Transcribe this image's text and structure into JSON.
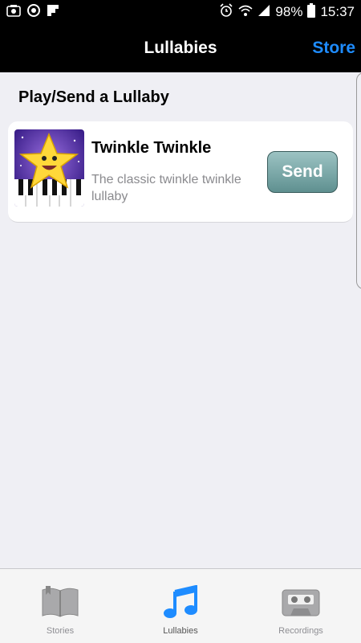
{
  "status_bar": {
    "battery": "98%",
    "time": "15:37"
  },
  "nav": {
    "title": "Lullabies",
    "store_label": "Store"
  },
  "section": {
    "title": "Play/Send a Lullaby"
  },
  "items": [
    {
      "title": "Twinkle Twinkle",
      "description": "The classic twinkle twinkle lullaby",
      "send_label": "Send",
      "thumbnail_icon": "star-piano-icon"
    }
  ],
  "tabs": [
    {
      "label": "Stories",
      "icon": "book-icon",
      "active": false
    },
    {
      "label": "Lullabies",
      "icon": "music-note-icon",
      "active": true
    },
    {
      "label": "Recordings",
      "icon": "cassette-icon",
      "active": false
    }
  ],
  "colors": {
    "accent": "#1e8cff",
    "nav_background": "#000000",
    "page_background": "#efeff4",
    "send_button": "#7aa9a9"
  }
}
